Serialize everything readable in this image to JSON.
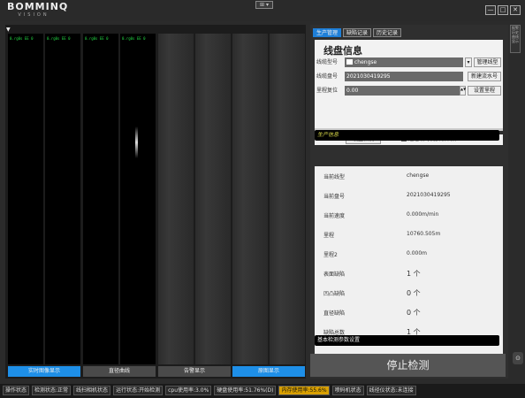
{
  "app": {
    "logo_main": "BOMMINQ",
    "logo_sub": "VISION",
    "top_mini": "⊞ ▾",
    "window_buttons": [
      "—",
      "□",
      "✕"
    ]
  },
  "cameras": {
    "arrow": "▼",
    "labels": [
      "0.rg0s EE 0",
      "0.rg0s EE 0",
      "0.rg0s EE 0",
      "0.rg0s EE 0"
    ]
  },
  "bottom_tabs": [
    {
      "label": "实时图像显示",
      "color": "#1e8fe8"
    },
    {
      "label": "直径曲线",
      "color": "#4a4a4a"
    },
    {
      "label": "告警显示",
      "color": "#4a4a4a"
    },
    {
      "label": "原图显示",
      "color": "#1e8fe8"
    }
  ],
  "panel": {
    "tabs": [
      "生产管理",
      "缺陷记录",
      "历史记录"
    ],
    "info_title": "线盘信息",
    "wire_type_label": "线缆型号",
    "wire_type_value": "chengse",
    "manage_wire_btn": "管理线型",
    "reel_no_label": "线缆盘号",
    "reel_no_value": "2021030419295",
    "new_flow_btn": "新建流水号",
    "mileage_label": "里程复位",
    "mileage_value": "0.00",
    "set_mileage_btn": "设置里程",
    "set_camera_btn": "设置相机",
    "encoder_check_label": "通过编码机获取米数",
    "production_section": "生产信息",
    "production": [
      {
        "key": "当前线型",
        "value": "chengse"
      },
      {
        "key": "当前盘号",
        "value": "2021030419295"
      },
      {
        "key": "当前速度",
        "value": "0.000m/min"
      },
      {
        "key": "里程",
        "value": "10760.505m"
      },
      {
        "key": "里程2",
        "value": "0.000m"
      },
      {
        "key": "表面缺陷",
        "value": "1 个"
      },
      {
        "key": "凹凸缺陷",
        "value": "0 个"
      },
      {
        "key": "直径缺陷",
        "value": "0 个"
      },
      {
        "key": "缺陷总数",
        "value": "1 个"
      }
    ],
    "params_section": "基本检测参数设置",
    "stop_btn": "停止检测"
  },
  "side": {
    "strip_text": "报警历史曲线显示",
    "round_btn": "⊙"
  },
  "status": [
    {
      "text": "操作状态",
      "bg": "#2c2c2c"
    },
    {
      "text": "检测状态:正常",
      "bg": "#2c2c2c"
    },
    {
      "text": "线扫相机状态",
      "bg": "#2c2c2c"
    },
    {
      "text": "运行状态:开始检测",
      "bg": "#2c2c2c"
    },
    {
      "text": "cpu使用率:3.0%",
      "bg": "#2c2c2c"
    },
    {
      "text": "硬盘使用率:51.76%(D)",
      "bg": "#2c2c2c"
    },
    {
      "text": "内存使用率:55.6%",
      "bg": "#d9a000"
    },
    {
      "text": "喷码机状态",
      "bg": "#2c2c2c"
    },
    {
      "text": "线径仪状态:未连接",
      "bg": "#2c2c2c"
    }
  ]
}
